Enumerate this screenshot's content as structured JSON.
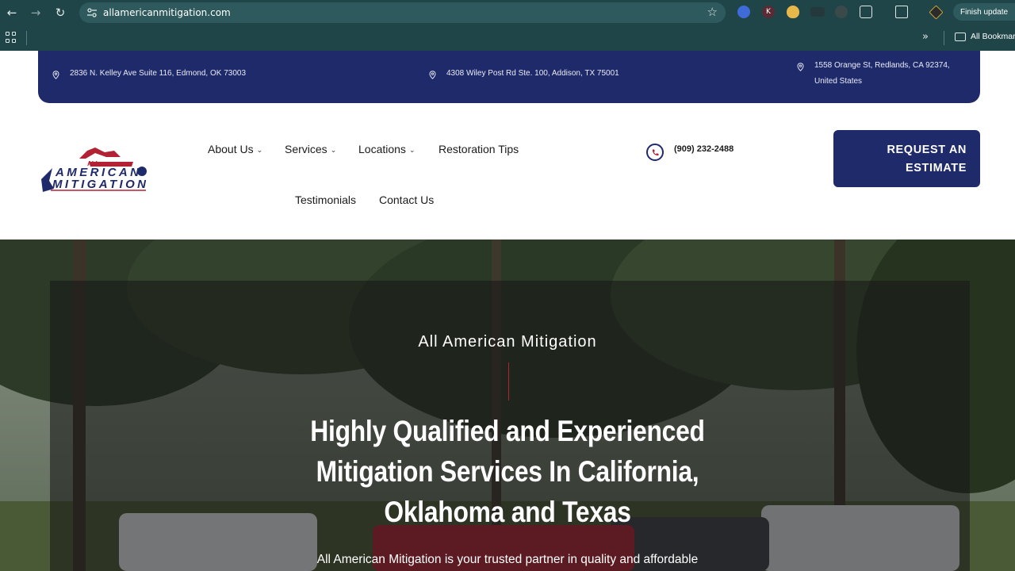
{
  "browser": {
    "url": "allamericanmitigation.com",
    "finish_update_label": "Finish update",
    "all_bookmarks_label": "All Bookmarks",
    "extension_k_label": "K"
  },
  "addresses": [
    "2836 N. Kelley Ave Suite 116, Edmond, OK 73003",
    "4308 Wiley Post Rd Ste. 100, Addison, TX 75001",
    "1558 Orange St, Redlands, CA 92374,",
    "United States"
  ],
  "logo": {
    "line1": "ALL",
    "line2": "AMERICAN",
    "line3": "MITIGATION"
  },
  "nav": {
    "about": "About Us",
    "services": "Services",
    "locations": "Locations",
    "restoration": "Restoration Tips",
    "testimonials": "Testimonials",
    "contact": "Contact Us"
  },
  "phone": "(909) 232-2488",
  "cta": {
    "line1": "REQUEST AN",
    "line2": "ESTIMATE"
  },
  "hero": {
    "eyebrow": "All American Mitigation",
    "title_line1": "Highly Qualified and Experienced",
    "title_line2": "Mitigation Services In California,",
    "title_line3": "Oklahoma and Texas",
    "subtitle": "All American Mitigation is your trusted partner in quality and affordable"
  },
  "colors": {
    "brand_navy": "#1f2a6b",
    "brand_red": "#b22234",
    "chrome_teal": "#1f4548"
  }
}
